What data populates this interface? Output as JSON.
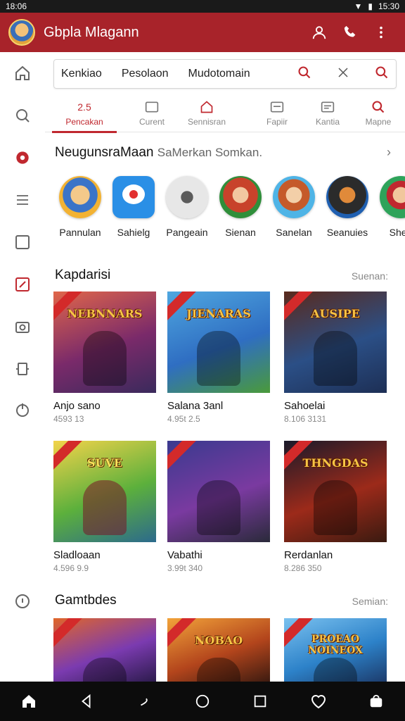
{
  "status": {
    "time": "18:06",
    "clock": "15:30"
  },
  "appbar": {
    "title": "Gbpla Mlagann",
    "icons": [
      "user-icon",
      "phone-icon",
      "more-vert-icon"
    ]
  },
  "sidebar": {
    "icons": [
      "home-icon",
      "search-icon",
      "settings-icon",
      "list-icon",
      "square-icon",
      "edit-icon",
      "camera-icon",
      "tray-icon",
      "power-icon",
      "info-icon"
    ]
  },
  "search": {
    "q1": "Kenkiao",
    "q2": "Pesolaon",
    "q3": "Mudotomain"
  },
  "tabs": [
    {
      "top": "2.5",
      "label": "Pencakan",
      "active": true
    },
    {
      "label": "Curent"
    },
    {
      "label": "Sennisran"
    },
    {
      "label": "Fapiir"
    },
    {
      "label": "Kantia"
    },
    {
      "label": "Mapne"
    }
  ],
  "section1": {
    "title": "NeugunsraMaan",
    "sub": "SaMerkan Somkan."
  },
  "apps": [
    {
      "name": "Pannulan"
    },
    {
      "name": "Sahielg"
    },
    {
      "name": "Pangeain"
    },
    {
      "name": "Sienan"
    },
    {
      "name": "Sanelan"
    },
    {
      "name": "Seanuies"
    },
    {
      "name": "Shen"
    }
  ],
  "section2": {
    "title": "Kapdarisi",
    "more": "Suenan:"
  },
  "cards": [
    {
      "banner": "NEBNNARS",
      "name": "Anjo sano",
      "meta": "4593 13",
      "color": "#c9421f"
    },
    {
      "banner": "JIENARAS",
      "name": "Salana 3anl",
      "meta": "4.95t 2.5",
      "color": "#3b7bbf"
    },
    {
      "banner": "AUSIPE",
      "name": "Sahoelai",
      "meta": "8.106 3131",
      "color": "#2f6da8"
    },
    {
      "banner": "SUVE",
      "name": "Sladloaan",
      "meta": "4.596 9.9",
      "color": "#5cab3a"
    },
    {
      "banner": "",
      "name": "Vabathi",
      "meta": "3.99t 340",
      "color": "#3c3a8f"
    },
    {
      "banner": "THNGDAS",
      "name": "Rerdanlan",
      "meta": "8.286 350",
      "color": "#9c2a1a"
    }
  ],
  "section3": {
    "title": "Gamtbdes",
    "more": "Semian:"
  },
  "cards2": [
    {
      "banner": "",
      "color": "#7b3bb0"
    },
    {
      "banner": "NOBAO",
      "color": "#b3451c"
    },
    {
      "banner": "PROEAO NOINEOX",
      "color": "#2d82c9"
    }
  ],
  "navbar": {
    "icons": [
      "home-icon",
      "back-icon",
      "gesture-icon",
      "circle-icon",
      "square-icon",
      "heart-icon",
      "bag-icon"
    ]
  }
}
